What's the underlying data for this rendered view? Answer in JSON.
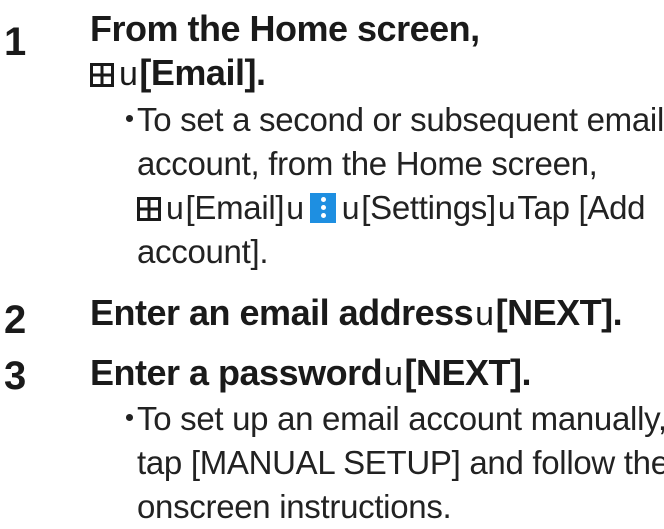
{
  "steps": [
    {
      "number": "1",
      "heading_line1": "From the Home screen,",
      "heading_line2_after_icon": "[Email].",
      "bullet": {
        "line1": "To set a second or subsequent email",
        "line2": "account, from the Home screen,",
        "line3_part1": "[Email]",
        "line3_part2": "[Settings]",
        "line3_part3": "Tap [Add",
        "line4": "account]."
      }
    },
    {
      "number": "2",
      "heading_part1": "Enter an email address",
      "heading_part2": "[NEXT]."
    },
    {
      "number": "3",
      "heading_part1": "Enter a password",
      "heading_part2": "[NEXT].",
      "bullet": {
        "line1": "To set up an email account manually,",
        "line2": "tap [MANUAL SETUP] and follow the",
        "line3": "onscreen instructions."
      }
    }
  ],
  "glyphs": {
    "arrow": "u",
    "bullet_dot": "・"
  },
  "icons": {
    "apps": "apps-grid-icon",
    "menu": "menu-more-icon"
  },
  "colors": {
    "menu_icon_bg": "#1e8fe1",
    "text": "#1a1a1a"
  }
}
